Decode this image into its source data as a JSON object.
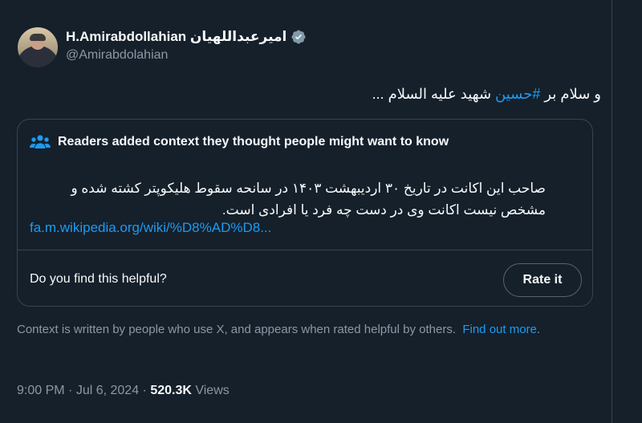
{
  "author": {
    "name": "H.Amirabdollahian امیرعبداللهیان",
    "handle": "@Amirabdolahian"
  },
  "tweet": {
    "text_prefix": "و سلام بر ",
    "hashtag": "#حسین",
    "text_suffix": " شهید علیه السلام ..."
  },
  "community_note": {
    "heading": "Readers added context they thought people might want to know",
    "body": "صاحب این اکانت در تاریخ ۳۰ اردیبهشت ۱۴۰۳ در سانحه سقوط هلیکوپتر کشته شده و مشخص نیست اکانت وی در دست چه فرد یا افرادی است.",
    "link": "fa.m.wikipedia.org/wiki/%D8%AD%D8...",
    "helpful_question": "Do you find this helpful?",
    "rate_button": "Rate it"
  },
  "context_info": {
    "text": "Context is written by people who use X, and appears when rated helpful by others.",
    "link": "Find out more"
  },
  "meta": {
    "time": "9:00 PM",
    "date": "Jul 6, 2024",
    "views_count": "520.3K",
    "views_label": "Views"
  },
  "colors": {
    "background": "#15202b",
    "accent": "#1d9bf0",
    "muted": "#8b98a5",
    "border": "#38444d"
  },
  "icons": [
    "verified-badge-icon",
    "people-icon"
  ]
}
